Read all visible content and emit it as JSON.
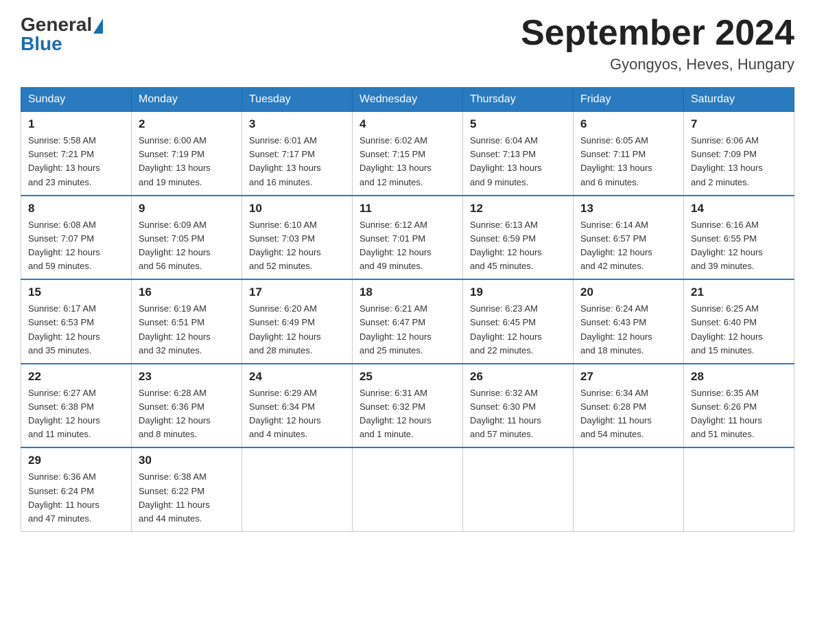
{
  "header": {
    "logo_general": "General",
    "logo_blue": "Blue",
    "title": "September 2024",
    "location": "Gyongyos, Heves, Hungary"
  },
  "days_of_week": [
    "Sunday",
    "Monday",
    "Tuesday",
    "Wednesday",
    "Thursday",
    "Friday",
    "Saturday"
  ],
  "weeks": [
    [
      {
        "day": "1",
        "info": "Sunrise: 5:58 AM\nSunset: 7:21 PM\nDaylight: 13 hours\nand 23 minutes."
      },
      {
        "day": "2",
        "info": "Sunrise: 6:00 AM\nSunset: 7:19 PM\nDaylight: 13 hours\nand 19 minutes."
      },
      {
        "day": "3",
        "info": "Sunrise: 6:01 AM\nSunset: 7:17 PM\nDaylight: 13 hours\nand 16 minutes."
      },
      {
        "day": "4",
        "info": "Sunrise: 6:02 AM\nSunset: 7:15 PM\nDaylight: 13 hours\nand 12 minutes."
      },
      {
        "day": "5",
        "info": "Sunrise: 6:04 AM\nSunset: 7:13 PM\nDaylight: 13 hours\nand 9 minutes."
      },
      {
        "day": "6",
        "info": "Sunrise: 6:05 AM\nSunset: 7:11 PM\nDaylight: 13 hours\nand 6 minutes."
      },
      {
        "day": "7",
        "info": "Sunrise: 6:06 AM\nSunset: 7:09 PM\nDaylight: 13 hours\nand 2 minutes."
      }
    ],
    [
      {
        "day": "8",
        "info": "Sunrise: 6:08 AM\nSunset: 7:07 PM\nDaylight: 12 hours\nand 59 minutes."
      },
      {
        "day": "9",
        "info": "Sunrise: 6:09 AM\nSunset: 7:05 PM\nDaylight: 12 hours\nand 56 minutes."
      },
      {
        "day": "10",
        "info": "Sunrise: 6:10 AM\nSunset: 7:03 PM\nDaylight: 12 hours\nand 52 minutes."
      },
      {
        "day": "11",
        "info": "Sunrise: 6:12 AM\nSunset: 7:01 PM\nDaylight: 12 hours\nand 49 minutes."
      },
      {
        "day": "12",
        "info": "Sunrise: 6:13 AM\nSunset: 6:59 PM\nDaylight: 12 hours\nand 45 minutes."
      },
      {
        "day": "13",
        "info": "Sunrise: 6:14 AM\nSunset: 6:57 PM\nDaylight: 12 hours\nand 42 minutes."
      },
      {
        "day": "14",
        "info": "Sunrise: 6:16 AM\nSunset: 6:55 PM\nDaylight: 12 hours\nand 39 minutes."
      }
    ],
    [
      {
        "day": "15",
        "info": "Sunrise: 6:17 AM\nSunset: 6:53 PM\nDaylight: 12 hours\nand 35 minutes."
      },
      {
        "day": "16",
        "info": "Sunrise: 6:19 AM\nSunset: 6:51 PM\nDaylight: 12 hours\nand 32 minutes."
      },
      {
        "day": "17",
        "info": "Sunrise: 6:20 AM\nSunset: 6:49 PM\nDaylight: 12 hours\nand 28 minutes."
      },
      {
        "day": "18",
        "info": "Sunrise: 6:21 AM\nSunset: 6:47 PM\nDaylight: 12 hours\nand 25 minutes."
      },
      {
        "day": "19",
        "info": "Sunrise: 6:23 AM\nSunset: 6:45 PM\nDaylight: 12 hours\nand 22 minutes."
      },
      {
        "day": "20",
        "info": "Sunrise: 6:24 AM\nSunset: 6:43 PM\nDaylight: 12 hours\nand 18 minutes."
      },
      {
        "day": "21",
        "info": "Sunrise: 6:25 AM\nSunset: 6:40 PM\nDaylight: 12 hours\nand 15 minutes."
      }
    ],
    [
      {
        "day": "22",
        "info": "Sunrise: 6:27 AM\nSunset: 6:38 PM\nDaylight: 12 hours\nand 11 minutes."
      },
      {
        "day": "23",
        "info": "Sunrise: 6:28 AM\nSunset: 6:36 PM\nDaylight: 12 hours\nand 8 minutes."
      },
      {
        "day": "24",
        "info": "Sunrise: 6:29 AM\nSunset: 6:34 PM\nDaylight: 12 hours\nand 4 minutes."
      },
      {
        "day": "25",
        "info": "Sunrise: 6:31 AM\nSunset: 6:32 PM\nDaylight: 12 hours\nand 1 minute."
      },
      {
        "day": "26",
        "info": "Sunrise: 6:32 AM\nSunset: 6:30 PM\nDaylight: 11 hours\nand 57 minutes."
      },
      {
        "day": "27",
        "info": "Sunrise: 6:34 AM\nSunset: 6:28 PM\nDaylight: 11 hours\nand 54 minutes."
      },
      {
        "day": "28",
        "info": "Sunrise: 6:35 AM\nSunset: 6:26 PM\nDaylight: 11 hours\nand 51 minutes."
      }
    ],
    [
      {
        "day": "29",
        "info": "Sunrise: 6:36 AM\nSunset: 6:24 PM\nDaylight: 11 hours\nand 47 minutes."
      },
      {
        "day": "30",
        "info": "Sunrise: 6:38 AM\nSunset: 6:22 PM\nDaylight: 11 hours\nand 44 minutes."
      },
      {
        "day": "",
        "info": ""
      },
      {
        "day": "",
        "info": ""
      },
      {
        "day": "",
        "info": ""
      },
      {
        "day": "",
        "info": ""
      },
      {
        "day": "",
        "info": ""
      }
    ]
  ]
}
